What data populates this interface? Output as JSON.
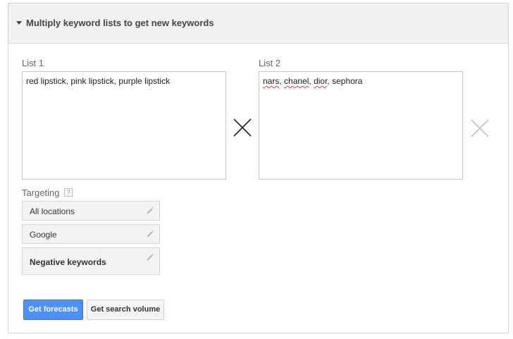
{
  "header": {
    "title": "Multiply keyword lists to get new keywords"
  },
  "list1": {
    "label": "List 1",
    "value": "red lipstick, pink lipstick, purple lipstick"
  },
  "list2": {
    "label": "List 2",
    "words": [
      "nars",
      "chanel",
      "dior",
      "sephora"
    ],
    "separator": ", "
  },
  "targeting": {
    "label": "Targeting",
    "help": "?",
    "items": [
      {
        "label": "All locations"
      },
      {
        "label": "Google"
      },
      {
        "label": "Negative keywords"
      }
    ]
  },
  "actions": {
    "primary_label": "Get forecasts",
    "secondary_label": "Get search volume"
  },
  "icons": {
    "multiply": "multiply-icon",
    "remove": "close-icon",
    "edit": "pencil-icon",
    "expand": "caret-down-icon"
  },
  "colors": {
    "primary_button": "#4d90fe",
    "header_background": "#f1f1f1",
    "spellcheck_underline": "#e03a3a"
  }
}
